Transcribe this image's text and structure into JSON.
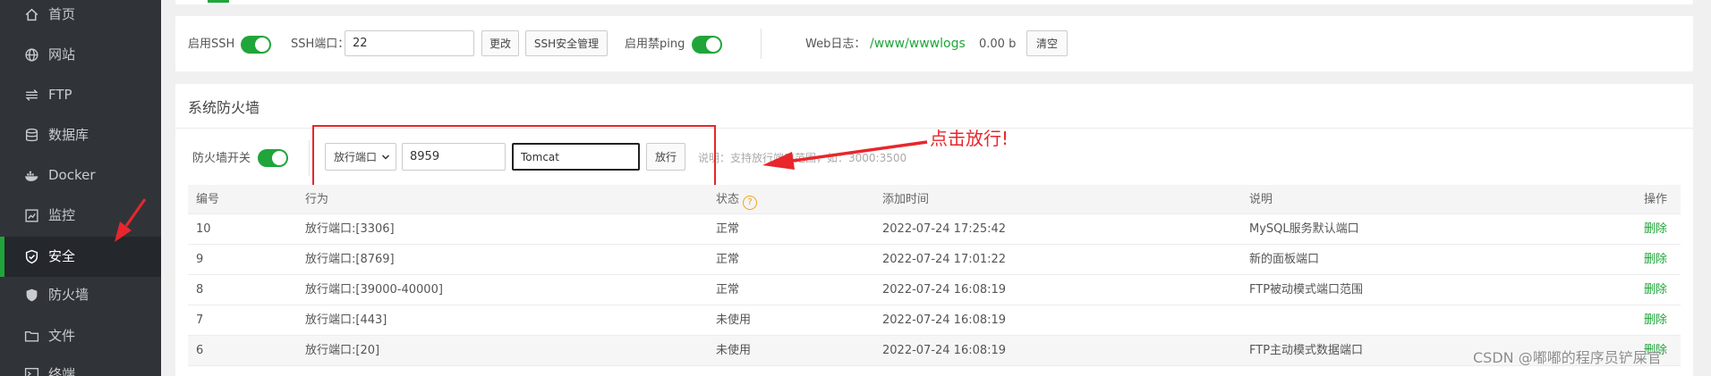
{
  "sidebar": {
    "items": [
      {
        "label": "首页",
        "icon": "home-icon"
      },
      {
        "label": "网站",
        "icon": "globe-icon"
      },
      {
        "label": "FTP",
        "icon": "ftp-icon"
      },
      {
        "label": "数据库",
        "icon": "database-icon"
      },
      {
        "label": "Docker",
        "icon": "docker-icon"
      },
      {
        "label": "监控",
        "icon": "monitor-icon"
      },
      {
        "label": "安全",
        "icon": "shield-icon"
      },
      {
        "label": "防火墙",
        "icon": "firewall-icon"
      },
      {
        "label": "文件",
        "icon": "folder-icon"
      },
      {
        "label": "终端",
        "icon": "terminal-icon"
      }
    ],
    "active": "安全"
  },
  "ssh_bar": {
    "ssh_label": "启用SSH",
    "ssh_enabled": true,
    "port_label": "SSH端口：",
    "port_value": "22",
    "change_button": "更改",
    "ssh_manage_button": "SSH安全管理",
    "ping_label": "启用禁ping",
    "ping_enabled": true,
    "weblog_label": "Web日志：",
    "weblog_path": "/www/wwwlogs",
    "weblog_size": "0.00 b",
    "clear_button": "清空"
  },
  "firewall": {
    "title": "系统防火墙",
    "switch_label": "防火墙开关",
    "switch_enabled": true,
    "rule_type": "放行端口",
    "port_value": "8959",
    "remark_value": "Tomcat",
    "allow_button": "放行",
    "hint": "说明：支持放行端口范围，如：3000:3500"
  },
  "table": {
    "headers": {
      "id": "编号",
      "action": "行为",
      "status": "状态",
      "time": "添加时间",
      "note": "说明",
      "op": "操作"
    },
    "rows": [
      {
        "id": "10",
        "action": "放行端口:[3306]",
        "status": "正常",
        "time": "2022-07-24 17:25:42",
        "note": "MySQL服务默认端口",
        "op": "删除"
      },
      {
        "id": "9",
        "action": "放行端口:[8769]",
        "status": "正常",
        "time": "2022-07-24 17:01:22",
        "note": "新的面板端口",
        "op": "删除"
      },
      {
        "id": "8",
        "action": "放行端口:[39000-40000]",
        "status": "正常",
        "time": "2022-07-24 16:08:19",
        "note": "FTP被动模式端口范围",
        "op": "删除"
      },
      {
        "id": "7",
        "action": "放行端口:[443]",
        "status": "未使用",
        "time": "2022-07-24 16:08:19",
        "note": "",
        "op": "删除"
      },
      {
        "id": "6",
        "action": "放行端口:[20]",
        "status": "未使用",
        "time": "2022-07-24 16:08:19",
        "note": "FTP主动模式数据端口",
        "op": "删除"
      }
    ]
  },
  "annotation": {
    "text": "点击放行!"
  },
  "watermark": "CSDN @嘟嘟的程序员铲屎官",
  "colors": {
    "accent": "#20a53a",
    "annotation": "#e8262c",
    "sidebar": "#303439"
  }
}
